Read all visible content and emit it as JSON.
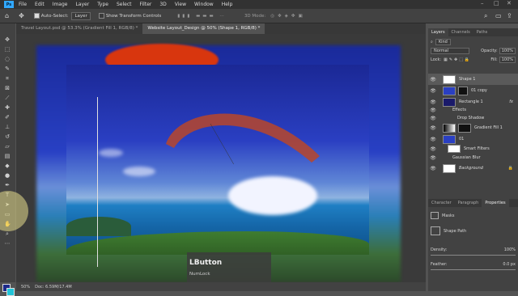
{
  "menubar": {
    "logo": "Ps",
    "items": [
      "File",
      "Edit",
      "Image",
      "Layer",
      "Type",
      "Select",
      "Filter",
      "3D",
      "View",
      "Window",
      "Help"
    ]
  },
  "options": {
    "auto_select": "Auto-Select:",
    "target": "Layer",
    "transform": "Show Transform Controls",
    "mode3d": "3D Mode:"
  },
  "tabs": [
    {
      "label": "Travel Layout.psd @ 53.3% (Gradient Fill 1, RGB/8) *"
    },
    {
      "label": "Website Layout_Design @ 50% (Shape 1, RGB/8) *"
    }
  ],
  "status": {
    "zoom": "50%",
    "doc": "Doc: 6.59M/17.4M"
  },
  "keyhint": {
    "button": "LButton",
    "key": "NumLock"
  },
  "panels": {
    "tabs": [
      "Layers",
      "Channels",
      "Paths"
    ],
    "kind": "Kind",
    "blend": "Normal",
    "opacity_label": "Opacity:",
    "opacity": "100%",
    "lock_label": "Lock:",
    "fill_label": "Fill:",
    "fill": "100%",
    "layers": [
      {
        "name": "Shape 1"
      },
      {
        "name": "01 copy"
      },
      {
        "name": "Rectangle 1"
      },
      {
        "name": "Effects"
      },
      {
        "name": "Drop Shadow"
      },
      {
        "name": "Gradient Fill 1"
      },
      {
        "name": "01"
      },
      {
        "name": "Smart Filters"
      },
      {
        "name": "Gaussian Blur"
      },
      {
        "name": "Background"
      }
    ],
    "bottom_tabs": [
      "Character",
      "Paragraph",
      "Properties"
    ],
    "masks": "Masks",
    "shape_path": "Shape Path",
    "density_label": "Density:",
    "density": "100%",
    "feather_label": "Feather:",
    "feather": "0.0 px"
  },
  "colors": {
    "foreground": "#1d2a8a",
    "background": "#22c4d8",
    "accent": "#31a8ff"
  }
}
